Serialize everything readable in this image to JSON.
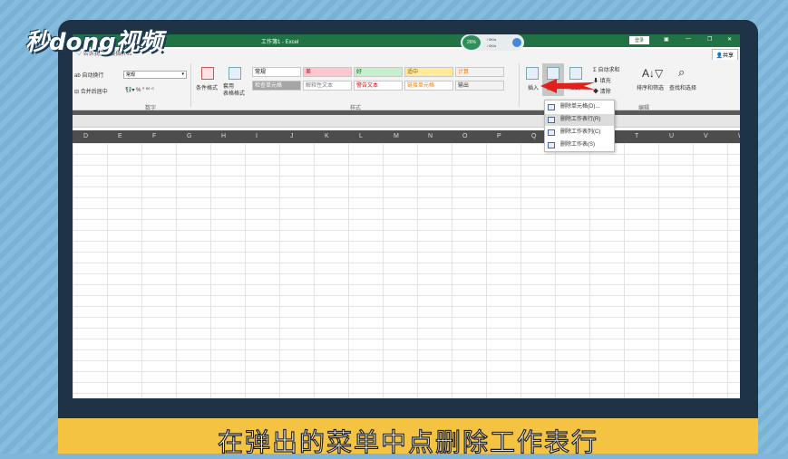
{
  "logo": {
    "text": "秒dong视频"
  },
  "window": {
    "title": "工作簿1 - Excel",
    "login": "登录",
    "share": "共享",
    "tell_me": "告诉我你想要做什么"
  },
  "status_widget": {
    "percent": "26%",
    "up": "0K/s",
    "down": "0K/s"
  },
  "ribbon": {
    "wrap_text": "自动换行",
    "merge_center": "合并后居中",
    "number_format": "常规",
    "number_group": "数字",
    "cond_format": "条件格式",
    "table_format": "套用\n表格格式",
    "styles_group": "样式",
    "styles": [
      {
        "label": "常规",
        "bg": "#ffffff",
        "fg": "#000000"
      },
      {
        "label": "差",
        "bg": "#ffc7ce",
        "fg": "#9c0006"
      },
      {
        "label": "好",
        "bg": "#c6efce",
        "fg": "#006100"
      },
      {
        "label": "适中",
        "bg": "#ffeb9c",
        "fg": "#9c5700"
      },
      {
        "label": "计算",
        "bg": "#f2f2f2",
        "fg": "#fa7d00"
      },
      {
        "label": "检查单元格",
        "bg": "#a5a5a5",
        "fg": "#ffffff"
      },
      {
        "label": "解释性文本",
        "bg": "#ffffff",
        "fg": "#7f7f7f"
      },
      {
        "label": "警告文本",
        "bg": "#ffffff",
        "fg": "#ff0000"
      },
      {
        "label": "链接单元格",
        "bg": "#ffffff",
        "fg": "#fa7d00"
      },
      {
        "label": "输出",
        "bg": "#f2f2f2",
        "fg": "#3f3f3f"
      }
    ],
    "insert": "插入",
    "delete": "删除",
    "format": "格式",
    "autosum": "自动求和",
    "fill": "填充",
    "clear": "清除",
    "sort_filter": "排序和筛选",
    "find_select": "查找和选择",
    "edit_group": "编辑"
  },
  "menu": {
    "items": [
      {
        "label": "删除单元格(D)..."
      },
      {
        "label": "删除工作表行(R)"
      },
      {
        "label": "删除工作表列(C)"
      },
      {
        "label": "删除工作表(S)"
      }
    ],
    "highlighted_index": 1
  },
  "columns": [
    "D",
    "E",
    "F",
    "G",
    "H",
    "I",
    "J",
    "K",
    "L",
    "M",
    "N",
    "O",
    "P",
    "Q",
    "R",
    "S",
    "T",
    "U",
    "V",
    "W"
  ],
  "subtitle": "在弹出的菜单中点删除工作表行"
}
